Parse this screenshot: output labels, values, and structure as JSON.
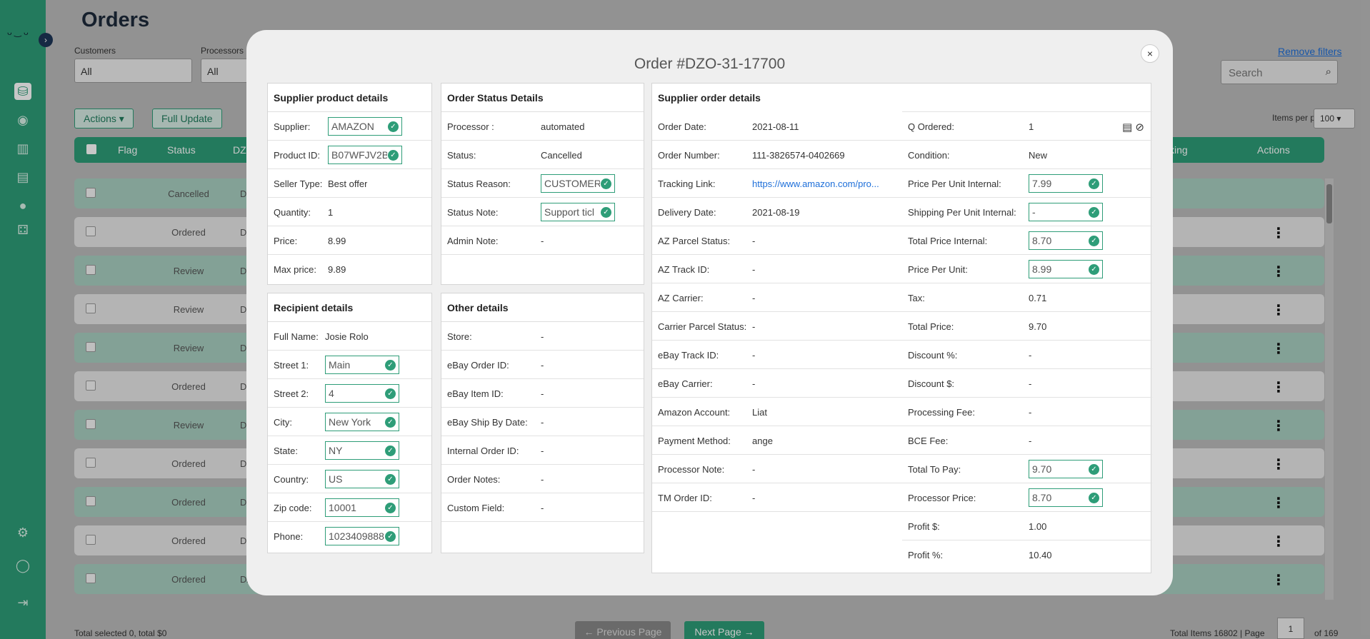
{
  "page": {
    "title": "Orders",
    "filters": [
      {
        "label": "Customers",
        "value": "All"
      },
      {
        "label": "Processors",
        "value": "All"
      }
    ],
    "remove_filters": "Remove filters",
    "search_placeholder": "Search",
    "actions_label": "Actions",
    "full_update_label": "Full Update",
    "items_per_page_label": "Items per page",
    "items_per_page_value": "100",
    "table_headers": {
      "flag": "Flag",
      "status": "Status",
      "dz": "DZ",
      "tracking": "king",
      "actions": "Actions"
    },
    "rows": [
      {
        "status": "Cancelled",
        "dz": "DZO"
      },
      {
        "status": "Ordered",
        "dz": "DZO"
      },
      {
        "status": "Review",
        "dz": "DZO"
      },
      {
        "status": "Review",
        "dz": "DZO"
      },
      {
        "status": "Review",
        "dz": "DZO"
      },
      {
        "status": "Ordered",
        "dz": "DZO"
      },
      {
        "status": "Review",
        "dz": "DZO"
      },
      {
        "status": "Ordered",
        "dz": "DZO"
      },
      {
        "status": "Ordered",
        "dz": "DZO"
      },
      {
        "status": "Ordered",
        "dz": "DZO"
      },
      {
        "status": "Ordered",
        "dz": "DZO"
      }
    ],
    "footer_left": "Total selected 0, total $0",
    "prev_label": "← Previous Page",
    "next_label": "Next Page →",
    "footer_right": "Total Items 16802 | Page",
    "page_number": "1",
    "of_total": "of 169"
  },
  "modal": {
    "title": "Order #DZO-31-17700",
    "close": "×",
    "supplier_product": {
      "title": "Supplier product details",
      "fields": [
        {
          "label": "Supplier:",
          "value": "AMAZON",
          "editable": true
        },
        {
          "label": "Product ID:",
          "value": "B07WFJV2B",
          "editable": true
        },
        {
          "label": "Seller Type:",
          "value": "Best offer"
        },
        {
          "label": "Quantity:",
          "value": "1"
        },
        {
          "label": "Price:",
          "value": "8.99"
        },
        {
          "label": "Max price:",
          "value": "9.89"
        }
      ]
    },
    "order_status": {
      "title": "Order Status Details",
      "fields": [
        {
          "label": "Processor :",
          "value": "automated"
        },
        {
          "label": "Status:",
          "value": "Cancelled"
        },
        {
          "label": "Status Reason:",
          "value": "CUSTOMER",
          "editable": true
        },
        {
          "label": "Status Note:",
          "value": "Support ticl",
          "editable": true
        },
        {
          "label": "Admin Note:",
          "value": "-"
        }
      ]
    },
    "recipient": {
      "title": "Recipient details",
      "fields": [
        {
          "label": "Full Name:",
          "value": "Josie Rolo"
        },
        {
          "label": "Street 1:",
          "value": "Main",
          "editable": true
        },
        {
          "label": "Street 2:",
          "value": "4",
          "editable": true
        },
        {
          "label": "City:",
          "value": "New York",
          "editable": true
        },
        {
          "label": "State:",
          "value": "NY",
          "editable": true
        },
        {
          "label": "Country:",
          "value": "US",
          "editable": true
        },
        {
          "label": "Zip code:",
          "value": "10001",
          "editable": true
        },
        {
          "label": "Phone:",
          "value": "1023409888",
          "editable": true
        }
      ]
    },
    "other": {
      "title": "Other details",
      "fields": [
        {
          "label": "Store:",
          "value": "-"
        },
        {
          "label": "eBay Order ID:",
          "value": "-"
        },
        {
          "label": "eBay Item ID:",
          "value": "-"
        },
        {
          "label": "eBay Ship By Date:",
          "value": "-"
        },
        {
          "label": "Internal Order ID:",
          "value": "-"
        },
        {
          "label": "Order Notes:",
          "value": "-"
        },
        {
          "label": "Custom Field:",
          "value": "-"
        }
      ]
    },
    "supplier_order": {
      "title": "Supplier order details",
      "left_fields": [
        {
          "label": "Order Date:",
          "value": "2021-08-11"
        },
        {
          "label": "Order Number:",
          "value": "111-3826574-0402669"
        },
        {
          "label": "Tracking Link:",
          "value": "https://www.amazon.com/pro...",
          "link": true
        },
        {
          "label": "Delivery Date:",
          "value": "2021-08-19"
        },
        {
          "label": "AZ Parcel Status:",
          "value": "-"
        },
        {
          "label": "AZ Track ID:",
          "value": "-"
        },
        {
          "label": "AZ Carrier:",
          "value": "-"
        },
        {
          "label": "Carrier Parcel Status:",
          "value": "-"
        },
        {
          "label": "eBay Track ID:",
          "value": "-"
        },
        {
          "label": "eBay Carrier:",
          "value": "-"
        },
        {
          "label": "Amazon Account:",
          "value": "Liat"
        },
        {
          "label": "Payment Method:",
          "value": "ange"
        },
        {
          "label": "Processor Note:",
          "value": "-"
        },
        {
          "label": "TM Order ID:",
          "value": "-"
        }
      ],
      "right_fields": [
        {
          "label": "Q Ordered:",
          "value": "1"
        },
        {
          "label": "Condition:",
          "value": "New"
        },
        {
          "label": "Price Per Unit Internal:",
          "value": "7.99",
          "editable": true
        },
        {
          "label": "Shipping Per Unit Internal:",
          "value": "-",
          "editable": true
        },
        {
          "label": "Total Price Internal:",
          "value": "8.70",
          "editable": true
        },
        {
          "label": "Price Per Unit:",
          "value": "8.99",
          "editable": true
        },
        {
          "label": "Tax:",
          "value": "0.71"
        },
        {
          "label": "Total Price:",
          "value": "9.70"
        },
        {
          "label": "Discount %:",
          "value": "-"
        },
        {
          "label": "Discount $:",
          "value": "-"
        },
        {
          "label": "Processing Fee:",
          "value": "-"
        },
        {
          "label": "BCE Fee:",
          "value": "-"
        },
        {
          "label": "Total To Pay:",
          "value": "9.70",
          "editable": true
        },
        {
          "label": "Processor Price:",
          "value": "8.70",
          "editable": true
        },
        {
          "label": "Profit $:",
          "value": "1.00"
        },
        {
          "label": "Profit %:",
          "value": "10.40"
        }
      ]
    }
  }
}
